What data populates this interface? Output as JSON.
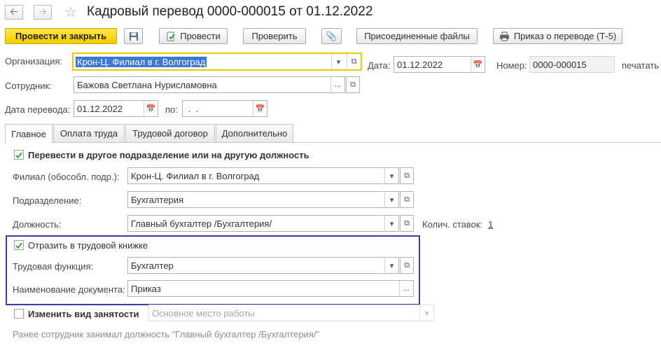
{
  "header": {
    "title": "Кадровый перевод 0000-000015 от 01.12.2022",
    "back_icon": "arrow-left",
    "forward_icon": "arrow-right",
    "favorite_icon": "star-outline"
  },
  "toolbar": {
    "post_and_close": "Провести и закрыть",
    "save_icon": "floppy-disk",
    "post": "Провести",
    "check": "Проверить",
    "attach_icon": "paperclip",
    "attached_files": "Присоединенные файлы",
    "print_order": "Приказ о переводе (Т-5)"
  },
  "form": {
    "organization_label": "Организация:",
    "organization_value": "Крон-Ц. Филиал в г. Волгоград",
    "date_label": "Дата:",
    "date_value": "01.12.2022",
    "number_label": "Номер:",
    "number_value": "0000-000015",
    "print_label": "печатать",
    "employee_label": "Сотрудник:",
    "employee_value": "Бажова Светлана Нурисламовна",
    "transfer_date_label": "Дата перевода:",
    "transfer_date_value": "01.12.2022",
    "to_label": "по:",
    "to_value": " .  . "
  },
  "tabs": [
    {
      "label": "Главное",
      "active": true
    },
    {
      "label": "Оплата труда",
      "active": false
    },
    {
      "label": "Трудовой договор",
      "active": false
    },
    {
      "label": "Дополнительно",
      "active": false
    }
  ],
  "main": {
    "transfer_checkbox_label": "Перевести в другое подразделение или на другую должность",
    "transfer_checked": true,
    "branch_label": "Филиал (обособл. подр.):",
    "branch_value": "Крон-Ц. Филиал в г. Волгоград",
    "department_label": "Подразделение:",
    "department_value": "Бухгалтерия",
    "position_label": "Должность:",
    "position_value": "Главный бухгалтер /Бухгалтерия/",
    "rates_label": "Колич. ставок:",
    "rates_value": "1",
    "workbook_checkbox_label": "Отразить в трудовой книжке",
    "workbook_checked": true,
    "labor_function_label": "Трудовая функция:",
    "labor_function_value": "Бухгалтер",
    "doc_name_label": "Наименование документа:",
    "doc_name_value": "Приказ",
    "employment_checkbox_label": "Изменить вид занятости",
    "employment_checked": false,
    "employment_value": "Основное место работы",
    "previous_note": "Ранее сотрудник занимал должность \"Главный бухгалтер /Бухгалтерия/\""
  },
  "colors": {
    "primary_button": "#f5cc00",
    "focus_border": "#f0c800",
    "highlight_frame": "#3a3fa8",
    "selection": "#3b78d8",
    "check_green": "#2e9e3a"
  }
}
